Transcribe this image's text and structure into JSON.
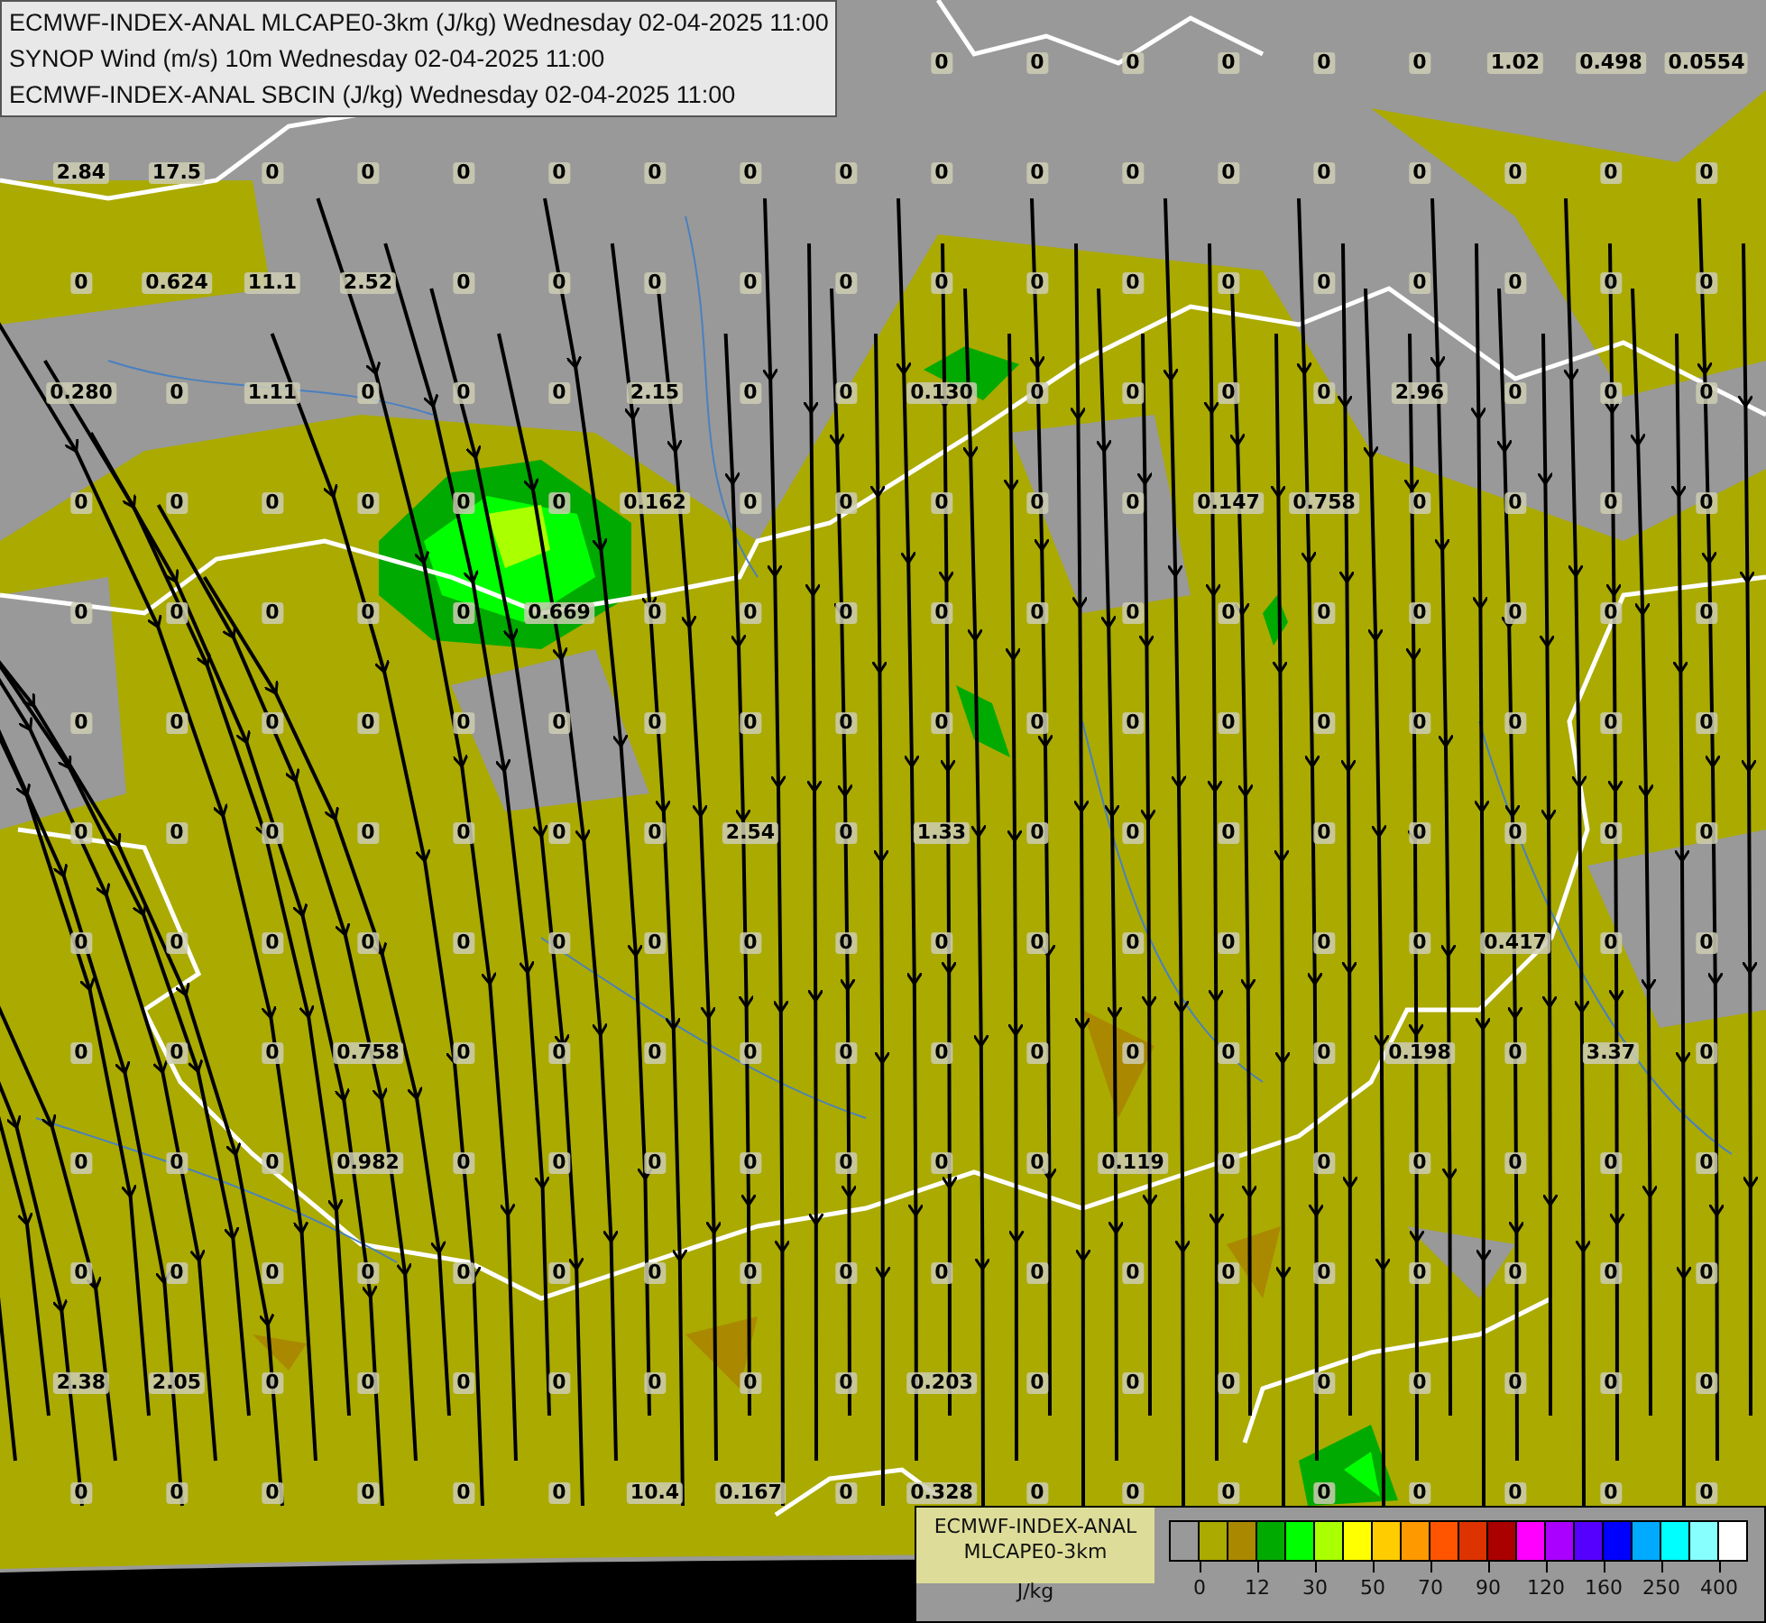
{
  "title_box": {
    "lines": [
      "ECMWF-INDEX-ANAL MLCAPE0-3km (J/kg) Wednesday 02-04-2025 11:00",
      "SYNOP Wind (m/s) 10m Wednesday 02-04-2025 11:00",
      "ECMWF-INDEX-ANAL SBCIN (J/kg) Wednesday 02-04-2025 11:00"
    ]
  },
  "stations": [
    [
      "0",
      "0",
      "0",
      "0",
      "0",
      "0",
      "1.02",
      "0.498",
      "0.0554"
    ],
    [
      "2.84",
      "17.5",
      "0",
      "0",
      "0",
      "0",
      "0",
      "0",
      "0",
      "0",
      "0",
      "0",
      "0",
      "0",
      "0",
      "0",
      "0",
      "0"
    ],
    [
      "0",
      "0.624",
      "11.1",
      "2.52",
      "0",
      "0",
      "0",
      "0",
      "0",
      "0",
      "0",
      "0",
      "0",
      "0",
      "0",
      "0",
      "0",
      "0"
    ],
    [
      "0.280",
      "0",
      "1.11",
      "0",
      "0",
      "0",
      "2.15",
      "0",
      "0",
      "0.130",
      "0",
      "0",
      "0",
      "0",
      "2.96",
      "0",
      "0",
      "0"
    ],
    [
      "0",
      "0",
      "0",
      "0",
      "0",
      "0",
      "0.162",
      "0",
      "0",
      "0",
      "0",
      "0",
      "0.147",
      "0.758",
      "0",
      "0",
      "0",
      "0"
    ],
    [
      "0",
      "0",
      "0",
      "0",
      "0",
      "0.669",
      "0",
      "0",
      "0",
      "0",
      "0",
      "0",
      "0",
      "0",
      "0",
      "0",
      "0",
      "0"
    ],
    [
      "0",
      "0",
      "0",
      "0",
      "0",
      "0",
      "0",
      "0",
      "0",
      "0",
      "0",
      "0",
      "0",
      "0",
      "0",
      "0",
      "0",
      "0"
    ],
    [
      "0",
      "0",
      "0",
      "0",
      "0",
      "0",
      "0",
      "2.54",
      "0",
      "1.33",
      "0",
      "0",
      "0",
      "0",
      "0",
      "0",
      "0",
      "0"
    ],
    [
      "0",
      "0",
      "0",
      "0",
      "0",
      "0",
      "0",
      "0",
      "0",
      "0",
      "0",
      "0",
      "0",
      "0",
      "0",
      "0.417",
      "0",
      "0"
    ],
    [
      "0",
      "0",
      "0",
      "0.758",
      "0",
      "0",
      "0",
      "0",
      "0",
      "0",
      "0",
      "0",
      "0",
      "0",
      "0.198",
      "0",
      "3.37",
      "0"
    ],
    [
      "0",
      "0",
      "0",
      "0.982",
      "0",
      "0",
      "0",
      "0",
      "0",
      "0",
      "0",
      "0.119",
      "0",
      "0",
      "0",
      "0",
      "0",
      "0"
    ],
    [
      "0",
      "0",
      "0",
      "0",
      "0",
      "0",
      "0",
      "0",
      "0",
      "0",
      "0",
      "0",
      "0",
      "0",
      "0",
      "0",
      "0",
      "0"
    ],
    [
      "2.38",
      "2.05",
      "0",
      "0",
      "0",
      "0",
      "0",
      "0",
      "0",
      "0.203",
      "0",
      "0",
      "0",
      "0",
      "0",
      "0",
      "0",
      "0"
    ],
    [
      "0",
      "0",
      "0",
      "0",
      "0",
      "0",
      "10.4",
      "0.167",
      "0",
      "0.328",
      "0",
      "0",
      "0",
      "0",
      "0",
      "0",
      "0",
      "0"
    ]
  ],
  "legend": {
    "title_lines": [
      "ECMWF-INDEX-ANAL",
      "MLCAPE0-3km"
    ],
    "unit": "J/kg",
    "swatches": [
      {
        "color": "#999999"
      },
      {
        "color": "#aaaa00"
      },
      {
        "color": "#aa8800"
      },
      {
        "color": "#00aa00"
      },
      {
        "color": "#00ff00"
      },
      {
        "color": "#aaff00"
      },
      {
        "color": "#ffff00"
      },
      {
        "color": "#ffcc00"
      },
      {
        "color": "#ff9900"
      },
      {
        "color": "#ff5500"
      },
      {
        "color": "#dd3300"
      },
      {
        "color": "#aa0000"
      },
      {
        "color": "#ff00ff"
      },
      {
        "color": "#aa00ff"
      },
      {
        "color": "#5500ff"
      },
      {
        "color": "#0000ff"
      },
      {
        "color": "#00aaff"
      },
      {
        "color": "#00ffff"
      },
      {
        "color": "#88ffff"
      },
      {
        "color": "#ffffff"
      }
    ],
    "tick_labels": [
      "0",
      "12",
      "30",
      "50",
      "70",
      "90",
      "120",
      "160",
      "250",
      "400"
    ]
  }
}
